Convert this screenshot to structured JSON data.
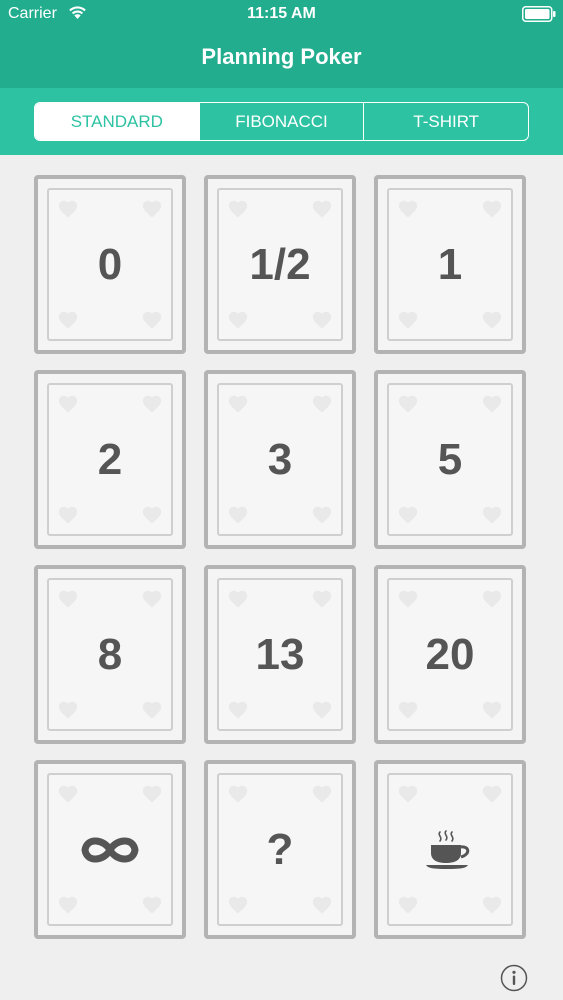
{
  "status_bar": {
    "carrier": "Carrier",
    "time": "11:15 AM"
  },
  "nav": {
    "title": "Planning Poker"
  },
  "tabs": [
    {
      "label": "STANDARD",
      "selected": true
    },
    {
      "label": "FIBONACCI",
      "selected": false
    },
    {
      "label": "T-SHIRT",
      "selected": false
    }
  ],
  "cards": [
    {
      "value": "0"
    },
    {
      "value": "1/2"
    },
    {
      "value": "1"
    },
    {
      "value": "2"
    },
    {
      "value": "3"
    },
    {
      "value": "5"
    },
    {
      "value": "8"
    },
    {
      "value": "13"
    },
    {
      "value": "20"
    },
    {
      "icon": "infinity-icon"
    },
    {
      "value": "?"
    },
    {
      "icon": "coffee-cup-icon"
    }
  ],
  "info_button": {
    "icon": "info-icon"
  },
  "colors": {
    "header": "#21ad8e",
    "toolbar": "#2cc2a2",
    "background": "#efefef",
    "card_border": "#b3b3b3",
    "card_text": "#555555"
  }
}
